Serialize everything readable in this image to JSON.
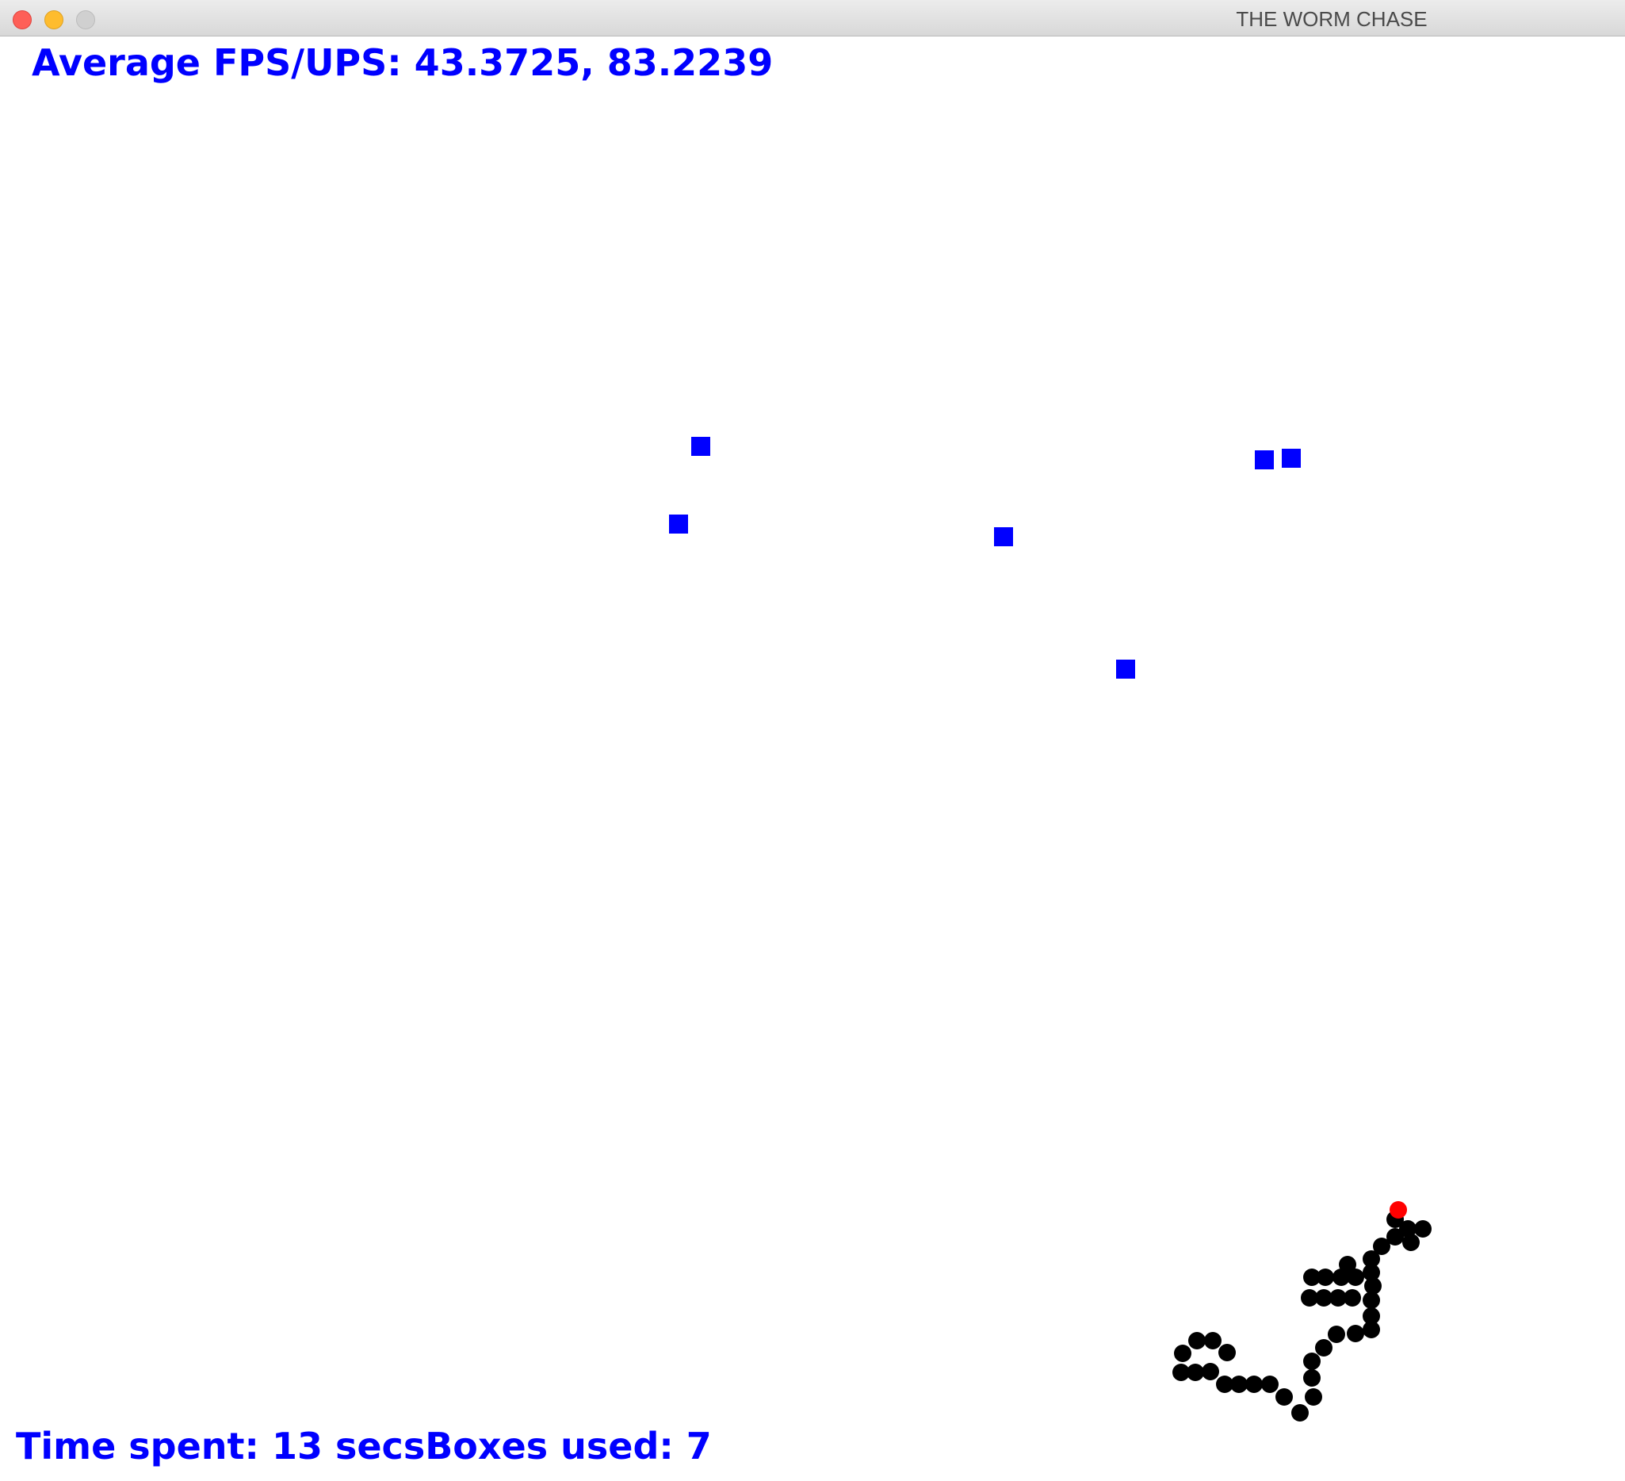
{
  "window": {
    "title": "THE WORM CHASE"
  },
  "hud": {
    "fps_text": "Average FPS/UPS: 43.3725, 83.2239",
    "time_text": "Time spent: 13 secs",
    "boxes_text": "Boxes used: 7"
  },
  "game": {
    "text_color": "#0000ff",
    "box_color": "#0000ff",
    "worm_body_color": "#000000",
    "worm_head_color": "#ff0000",
    "obstacle_count": 7,
    "worm_segments": 40
  }
}
